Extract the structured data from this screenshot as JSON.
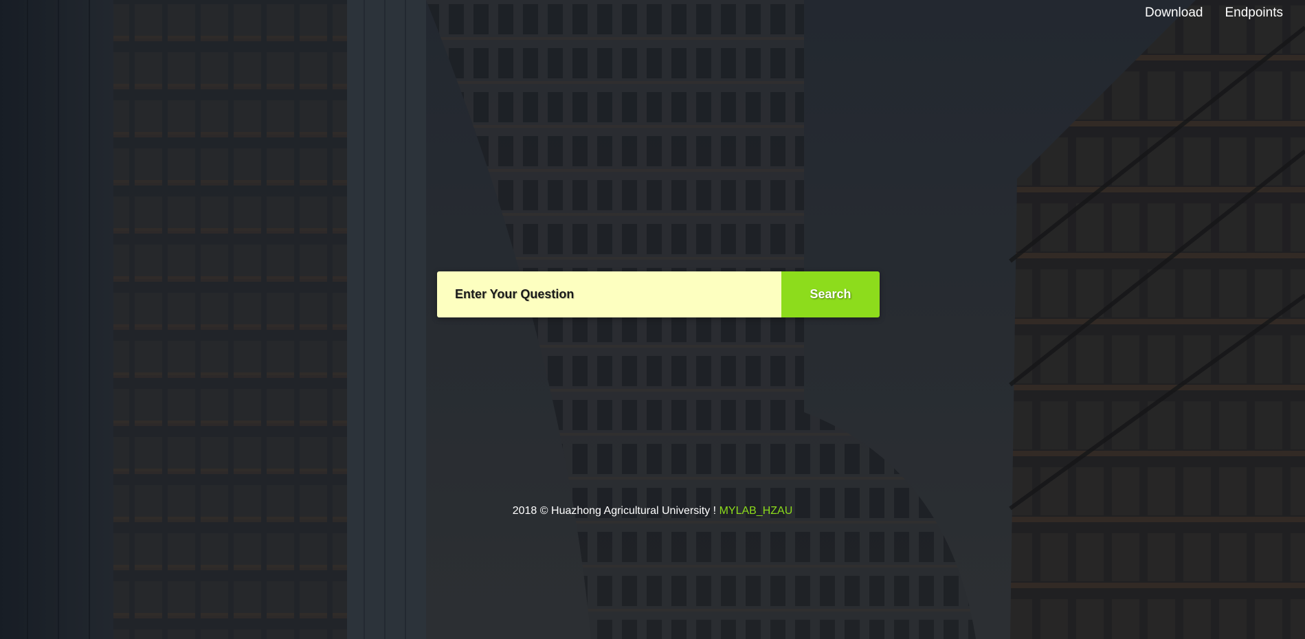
{
  "nav": {
    "items": [
      {
        "label": "Download"
      },
      {
        "label": "Endpoints"
      }
    ]
  },
  "search": {
    "placeholder": "Enter Your Question",
    "value": "",
    "button_label": "Search"
  },
  "footer": {
    "text": "2018 © Huazhong Agricultural University ! ",
    "brand": "MYLAB_HZAU"
  },
  "colors": {
    "accent": "#8ddc1c",
    "input_background": "#fdffc0",
    "page_background": "#262c33"
  }
}
